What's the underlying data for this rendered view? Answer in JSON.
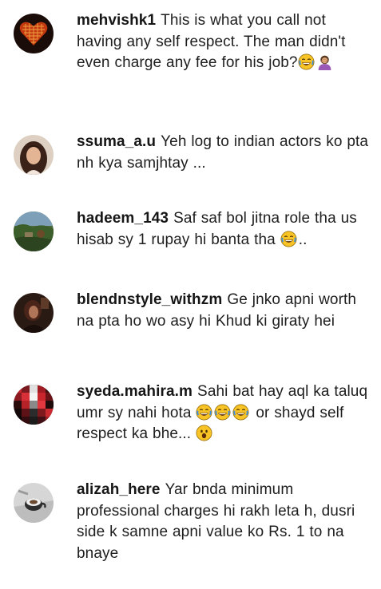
{
  "comments": [
    {
      "username": "mehvishk1",
      "text": "This is what you call not having any self respect. The man didn't even charge any fee for his job?",
      "trailing_emojis": [
        "joy-emoji",
        "facepalm-emoji"
      ],
      "avatar_icon": "heart-avatar"
    },
    {
      "username": "ssuma_a.u",
      "text": "Yeh log to indian actors ko pta nh kya samjhtay ...",
      "avatar_icon": "portrait-avatar"
    },
    {
      "username": "hadeem_143",
      "text": "Saf saf bol jitna role tha us hisab sy 1 rupay hi banta tha",
      "trailing_emojis": [
        "joy-emoji"
      ],
      "after_emoji_text": "..",
      "avatar_icon": "landscape-avatar"
    },
    {
      "username": "blendnstyle_withzm",
      "text": "Ge jnko apni worth na pta ho wo asy hi Khud ki giraty hei",
      "avatar_icon": "dark-portrait-avatar"
    },
    {
      "username": "syeda.mahira.m",
      "text_before": "Sahi bat hay aql ka taluq umr sy nahi hota",
      "inline_emojis": [
        "joy-emoji",
        "joy-emoji",
        "joy-emoji"
      ],
      "text_after": "or shayd self respect ka bhe...",
      "trailing_emojis": [
        "astonished-emoji"
      ],
      "avatar_icon": "pixelated-avatar"
    },
    {
      "username": "alizah_here",
      "text": "Yar bnda minimum professional charges hi rakh leta h, dusri side k samne apni value ko Rs. 1 to na bnaye",
      "avatar_icon": "cup-avatar"
    }
  ]
}
